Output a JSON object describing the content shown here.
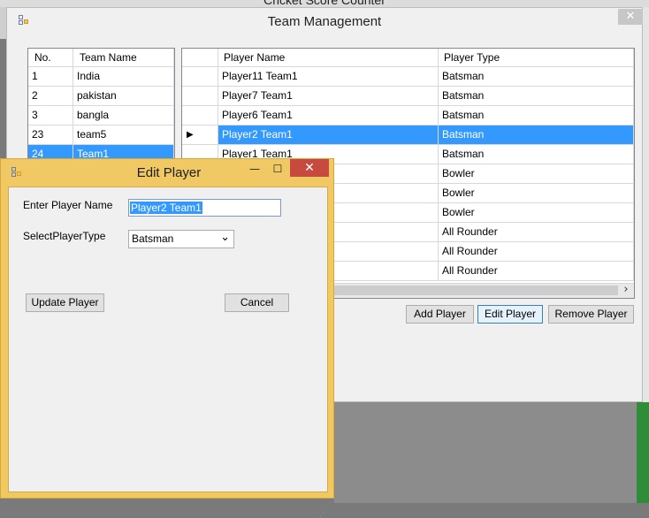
{
  "background_window": {
    "title": "Cricket Score Counter"
  },
  "team_window": {
    "title": "Team Management",
    "close_label": "✕",
    "teams_grid": {
      "headers": {
        "no": "No.",
        "name": "Team Name"
      },
      "rows": [
        {
          "no": "1",
          "name": "India"
        },
        {
          "no": "2",
          "name": "pakistan"
        },
        {
          "no": "3",
          "name": "bangla"
        },
        {
          "no": "23",
          "name": "team5"
        },
        {
          "no": "24",
          "name": "Team1"
        }
      ],
      "selected_index": 4
    },
    "players_grid": {
      "headers": {
        "name": "Player Name",
        "type": "Player Type"
      },
      "rows": [
        {
          "name": "Player11 Team1",
          "type": "Batsman"
        },
        {
          "name": "Player7 Team1",
          "type": "Batsman"
        },
        {
          "name": "Player6 Team1",
          "type": "Batsman"
        },
        {
          "name": "Player2 Team1",
          "type": "Batsman"
        },
        {
          "name": "Player1 Team1",
          "type": "Batsman"
        },
        {
          "name": "",
          "type": "Bowler"
        },
        {
          "name": "",
          "type": "Bowler"
        },
        {
          "name": "",
          "type": "Bowler"
        },
        {
          "name": "",
          "type": "All Rounder"
        },
        {
          "name": "",
          "type": "All Rounder"
        },
        {
          "name": "",
          "type": "All Rounder"
        }
      ],
      "selected_index": 3,
      "row_indicator": "▶",
      "scroll_right": "›"
    },
    "buttons": {
      "add": "Add Player",
      "edit": "Edit Player",
      "remove": "Remove Player"
    }
  },
  "edit_dialog": {
    "title": "Edit Player",
    "minimize": "—",
    "maximize": "☐",
    "close": "✕",
    "name_label": "Enter Player Name",
    "name_value": "Player2 Team1",
    "type_label": "SelectPlayerType",
    "type_value": "Batsman",
    "dropdown_arrow": "⌄",
    "update_button": "Update Player",
    "cancel_button": "Cancel"
  }
}
